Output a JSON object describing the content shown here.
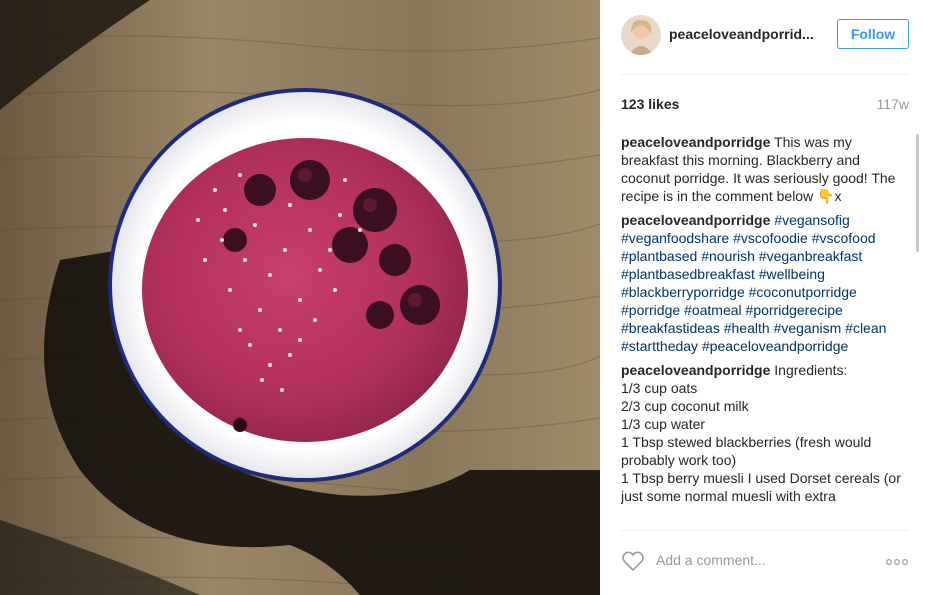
{
  "post": {
    "username": "peaceloveandporrid...",
    "follow_label": "Follow",
    "likes": "123 likes",
    "age": "117w",
    "add_comment_placeholder": "Add a comment..."
  },
  "comments": [
    {
      "user": "peaceloveandporridge",
      "text": " This was my breakfast this morning. Blackberry and coconut porridge. It was seriously good! The recipe is in the comment below ",
      "emoji": "👇",
      "after": "x"
    },
    {
      "user": "peaceloveandporridge",
      "tags": [
        "#vegansofig",
        "#veganfoodshare",
        "#vscofoodie",
        "#vscofood",
        "#plantbased",
        "#nourish",
        "#veganbreakfast",
        "#plantbasedbreakfast",
        "#wellbeing",
        "#blackberryporridge",
        "#coconutporridge",
        "#porridge",
        "#oatmeal",
        "#porridgerecipe",
        "#breakfastideas",
        "#health",
        "#veganism",
        "#clean",
        "#starttheday",
        "#peaceloveandporridge"
      ]
    },
    {
      "user": "peaceloveandporridge",
      "text": " Ingredients:",
      "lines": [
        "1/3 cup oats",
        "2/3 cup coconut milk",
        "1/3 cup water",
        "1 Tbsp stewed blackberries (fresh would probably work too)",
        "1 Tbsp berry muesli I used Dorset cereals (or just some normal muesli with extra"
      ]
    }
  ],
  "colors": {
    "accent": "#3897f0",
    "hashtag": "#003569",
    "muted": "#999999",
    "porridge": "#b8335d",
    "bowl_rim": "#1a237e",
    "wood": "#8a7558"
  },
  "icons": {
    "heart": "heart-outline-icon",
    "more": "more-options-icon"
  }
}
